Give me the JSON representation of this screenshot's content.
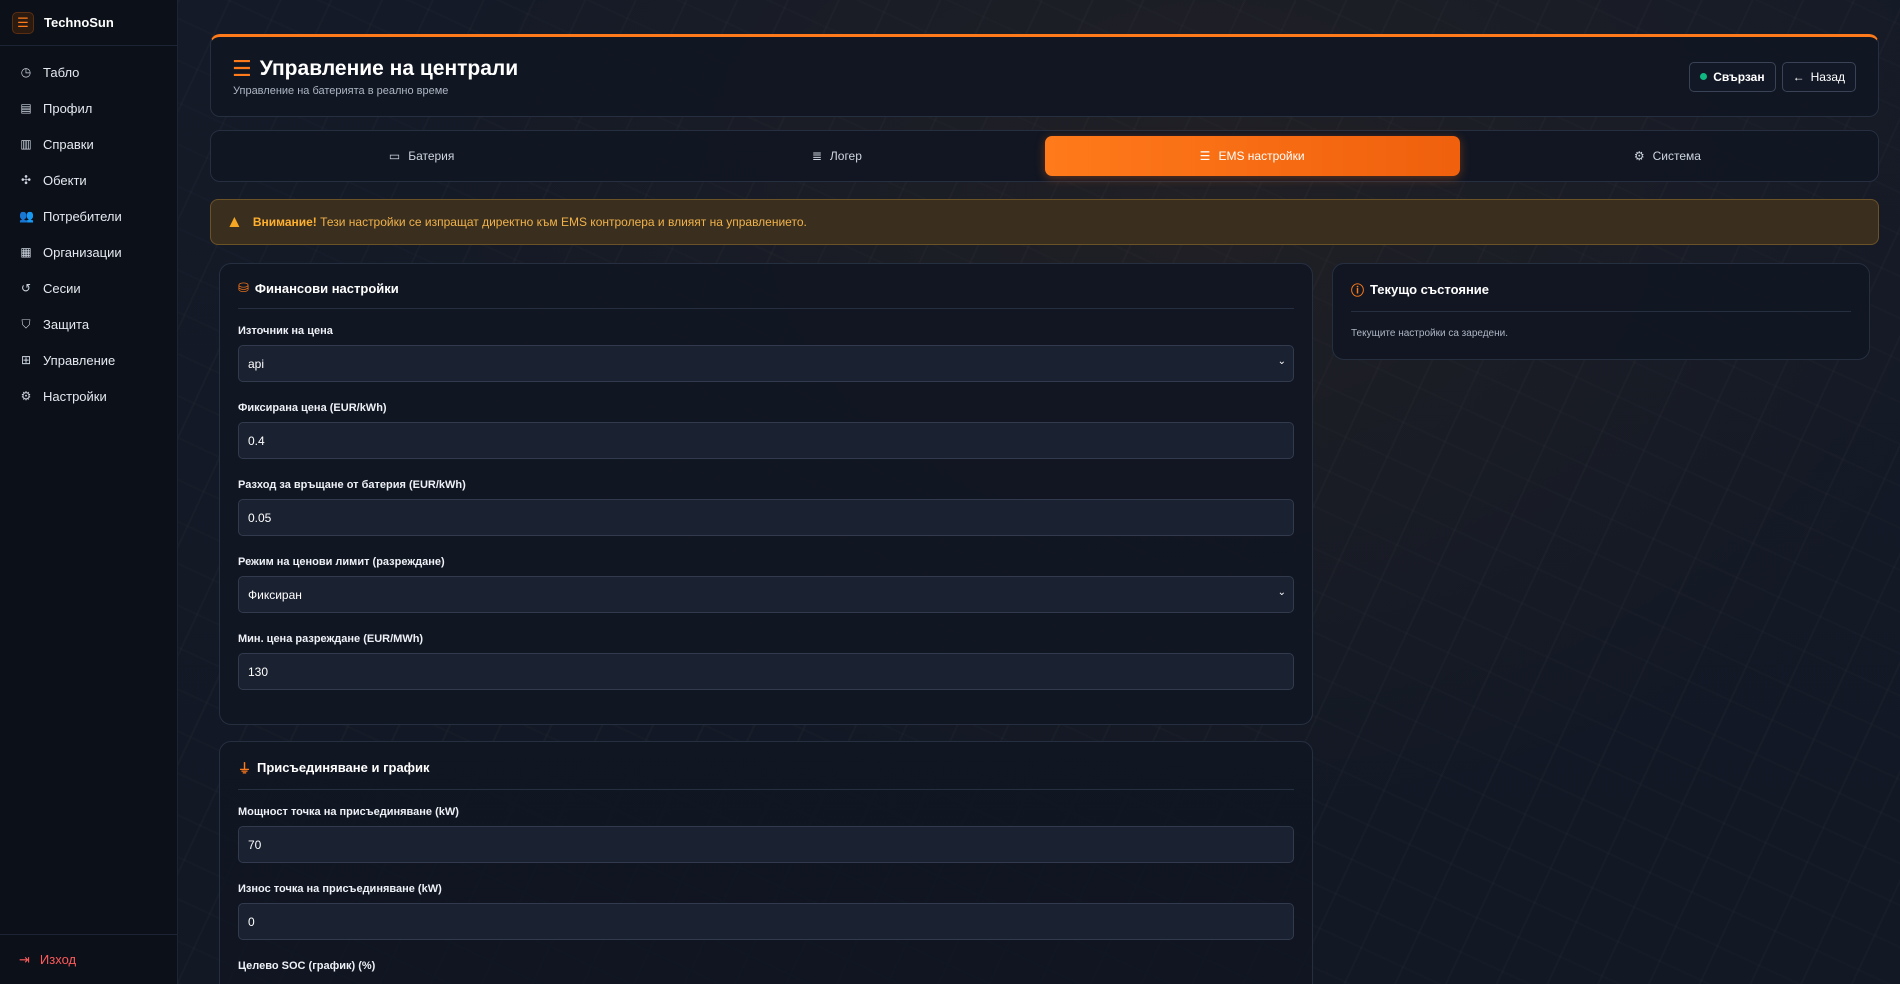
{
  "app": {
    "name": "TechnoSun"
  },
  "sidebar": {
    "items": [
      {
        "label": "Табло",
        "icon": "dashboard-icon"
      },
      {
        "label": "Профил",
        "icon": "id-card-icon"
      },
      {
        "label": "Справки",
        "icon": "file-icon"
      },
      {
        "label": "Обекти",
        "icon": "objects-icon"
      },
      {
        "label": "Потребители",
        "icon": "users-icon"
      },
      {
        "label": "Организации",
        "icon": "building-icon"
      },
      {
        "label": "Сесии",
        "icon": "history-icon"
      },
      {
        "label": "Защита",
        "icon": "shield-icon"
      },
      {
        "label": "Управление",
        "icon": "grid-icon"
      },
      {
        "label": "Настройки",
        "icon": "gear-icon"
      }
    ],
    "logout_label": "Изход"
  },
  "header": {
    "title": "Управление на централи",
    "subtitle": "Управление на батерията в реално време",
    "status_label": "Свързан",
    "back_label": "Назад"
  },
  "tabs": [
    {
      "label": "Батерия",
      "icon": "battery-icon",
      "active": false
    },
    {
      "label": "Логер",
      "icon": "database-icon",
      "active": false
    },
    {
      "label": "EMS настройки",
      "icon": "sliders-icon",
      "active": true
    },
    {
      "label": "Система",
      "icon": "cogs-icon",
      "active": false
    }
  ],
  "alert": {
    "strong": "Внимание!",
    "text": "Тези настройки се изпращат директно към EMS контролера и влияят на управлението."
  },
  "financial": {
    "title": "Финансови настройки",
    "price_source": {
      "label": "Източник на цена",
      "value": "api"
    },
    "fixed_price": {
      "label": "Фиксирана цена (EUR/kWh)",
      "value": "0.4"
    },
    "return_cost": {
      "label": "Разход за връщане от батерия (EUR/kWh)",
      "value": "0.05"
    },
    "price_limit_mode": {
      "label": "Режим на ценови лимит (разреждане)",
      "value": "Фиксиран"
    },
    "min_discharge_price": {
      "label": "Мин. цена разреждане (EUR/MWh)",
      "value": "130"
    }
  },
  "connection": {
    "title": "Присъединяване и график",
    "power": {
      "label": "Мощност точка на присъединяване (kW)",
      "value": "70"
    },
    "export": {
      "label": "Износ точка на присъединяване (kW)",
      "value": "0"
    },
    "target_soc": {
      "label": "Целево SOC (график) (%)"
    }
  },
  "status": {
    "title": "Текущо състояние",
    "text": "Текущите настройки са заредени."
  },
  "colors": {
    "accent": "#ff7a1a",
    "ok": "#10b981",
    "danger": "#ff5a5a",
    "warning": "#f5a623"
  }
}
